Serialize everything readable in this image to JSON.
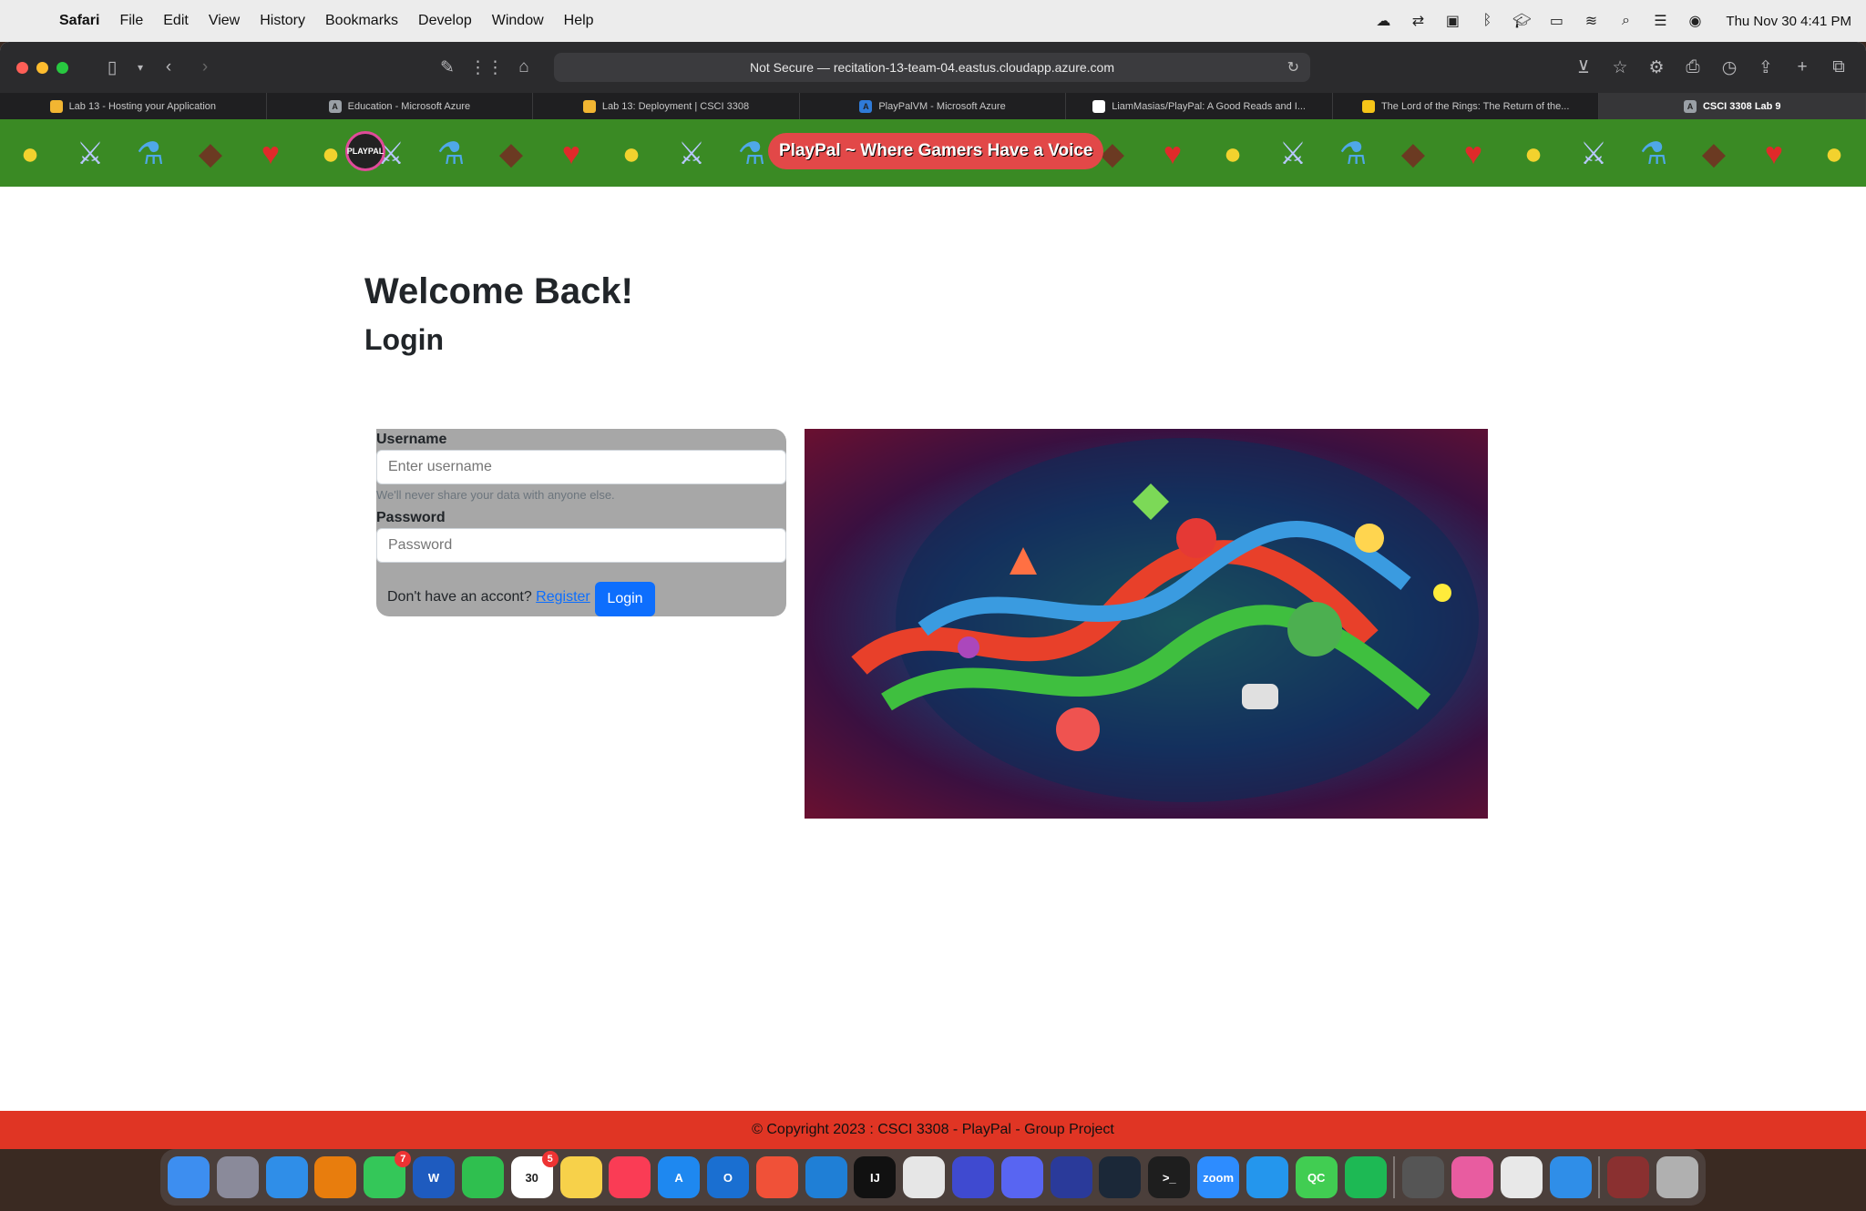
{
  "menubar": {
    "app_name": "Safari",
    "items": [
      "File",
      "Edit",
      "View",
      "History",
      "Bookmarks",
      "Develop",
      "Window",
      "Help"
    ],
    "clock": "Thu Nov 30  4:41 PM",
    "status_icons": [
      "creative-cloud-icon",
      "translate-icon",
      "screen-icon",
      "bluetooth-icon",
      "graduation-cap-icon",
      "battery-icon",
      "wifi-icon",
      "search-icon",
      "control-center-icon",
      "siri-icon"
    ]
  },
  "browser": {
    "address": "Not Secure — recitation-13-team-04.eastus.cloudapp.azure.com",
    "tabs": [
      {
        "label": "Lab 13 - Hosting your Application",
        "fav": "",
        "fav_color": "#f2b632",
        "active": false
      },
      {
        "label": "Education - Microsoft Azure",
        "fav": "A",
        "fav_color": "#9aa0a6",
        "active": false
      },
      {
        "label": "Lab 13: Deployment | CSCI 3308",
        "fav": "",
        "fav_color": "#f2b632",
        "active": false
      },
      {
        "label": "PlayPalVM - Microsoft Azure",
        "fav": "A",
        "fav_color": "#2f7bd8",
        "active": false
      },
      {
        "label": "LiamMasias/PlayPal: A Good Reads and I...",
        "fav": "",
        "fav_color": "#ffffff",
        "active": false
      },
      {
        "label": "The Lord of the Rings: The Return of the...",
        "fav": "",
        "fav_color": "#f5c518",
        "active": false
      },
      {
        "label": "CSCI 3308 Lab 9",
        "fav": "A",
        "fav_color": "#9aa0a6",
        "active": true
      }
    ]
  },
  "page": {
    "banner_tagline": "PlayPal ~ Where Gamers Have a Voice",
    "logo_text": "PLAYPAL",
    "welcome": "Welcome Back!",
    "login_title": "Login",
    "form": {
      "username_label": "Username",
      "username_placeholder": "Enter username",
      "username_help": "We'll never share your data with anyone else.",
      "password_label": "Password",
      "password_placeholder": "Password",
      "register_prompt": "Don't have an accont?",
      "register_link": "Register",
      "login_button": "Login"
    },
    "footer": "© Copyright 2023 : CSCI 3308 - PlayPal - Group Project"
  },
  "colors": {
    "banner_green": "#3a8a24",
    "tagline_red": "#e24848",
    "form_gray": "#a7a7a7",
    "primary_blue": "#0d6efd",
    "footer_red": "#e03524"
  },
  "dock": {
    "apps": [
      {
        "name": "finder",
        "label": "",
        "color": "#3d8ef0"
      },
      {
        "name": "launchpad",
        "label": "",
        "color": "#8a8a9a"
      },
      {
        "name": "safari",
        "label": "",
        "color": "#2f8ee8"
      },
      {
        "name": "blender",
        "label": "",
        "color": "#e87d0d"
      },
      {
        "name": "messages",
        "label": "",
        "color": "#34c759",
        "badge": "7"
      },
      {
        "name": "word",
        "label": "W",
        "color": "#1e5bbf"
      },
      {
        "name": "facetime",
        "label": "",
        "color": "#2fbf4f"
      },
      {
        "name": "calendar",
        "label": "30",
        "color": "#ffffff",
        "badge": "5"
      },
      {
        "name": "notes",
        "label": "",
        "color": "#f7d14a"
      },
      {
        "name": "music",
        "label": "",
        "color": "#fa3c55"
      },
      {
        "name": "app-store",
        "label": "A",
        "color": "#1e88f0"
      },
      {
        "name": "outlook",
        "label": "O",
        "color": "#1a6fd1"
      },
      {
        "name": "swift",
        "label": "",
        "color": "#f05138"
      },
      {
        "name": "vscode",
        "label": "",
        "color": "#1f7fd6"
      },
      {
        "name": "intellij",
        "label": "IJ",
        "color": "#111111"
      },
      {
        "name": "inkscape",
        "label": "",
        "color": "#e6e6e6"
      },
      {
        "name": "simulator",
        "label": "",
        "color": "#3f4ad0"
      },
      {
        "name": "discord",
        "label": "",
        "color": "#5865f2"
      },
      {
        "name": "webex",
        "label": "",
        "color": "#2a3a9a"
      },
      {
        "name": "steam",
        "label": "",
        "color": "#1b2838"
      },
      {
        "name": "terminal",
        "label": ">_",
        "color": "#1e1e1e"
      },
      {
        "name": "zoom",
        "label": "zoom",
        "color": "#2d8cff"
      },
      {
        "name": "docker",
        "label": "",
        "color": "#2496ed"
      },
      {
        "name": "qt-creator",
        "label": "QC",
        "color": "#41cd52"
      },
      {
        "name": "spotify",
        "label": "",
        "color": "#1db954"
      },
      {
        "name": "calculator",
        "label": "",
        "color": "#555555"
      },
      {
        "name": "photos-folder",
        "label": "",
        "color": "#e85ca0"
      },
      {
        "name": "chrome",
        "label": "",
        "color": "#e8e8e8"
      },
      {
        "name": "safari-downloads",
        "label": "",
        "color": "#2f8ee8"
      },
      {
        "name": "photo-stack",
        "label": "",
        "color": "#8a3030"
      },
      {
        "name": "trash",
        "label": "",
        "color": "#b0b0b0"
      }
    ]
  }
}
